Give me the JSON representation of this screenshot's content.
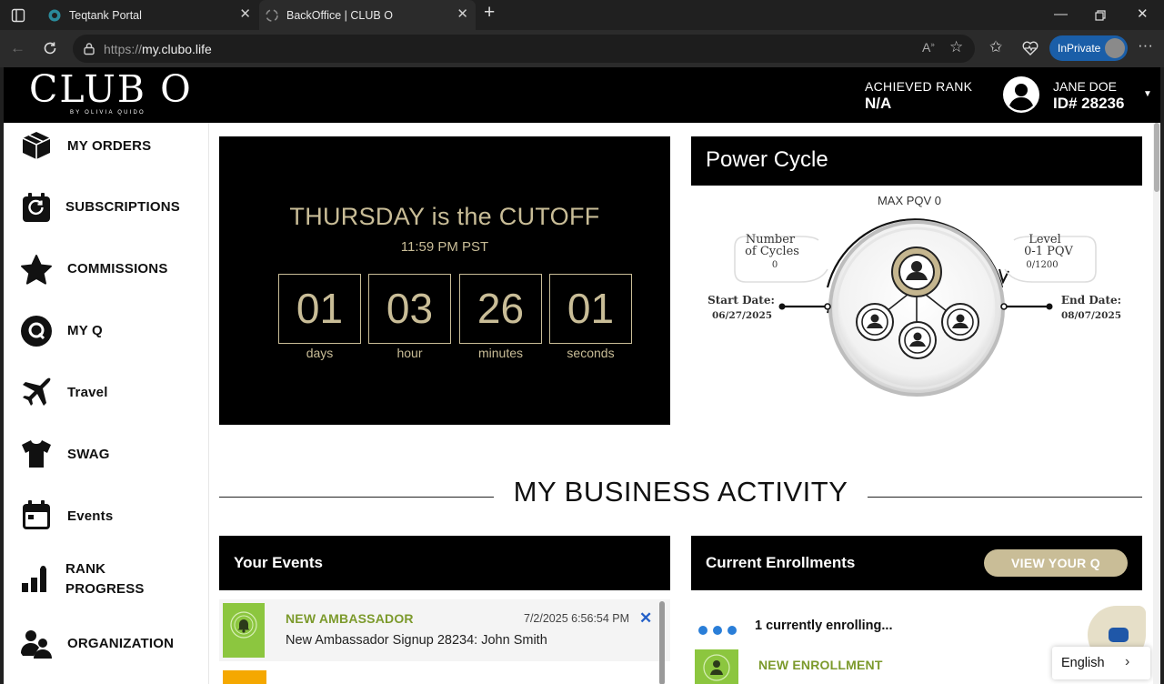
{
  "browser": {
    "tabs": [
      {
        "title": "Teqtank Portal",
        "icon": "teqtank-icon"
      },
      {
        "title": "BackOffice | CLUB O",
        "icon": "loading-icon",
        "active": true
      }
    ],
    "new_tab": "+",
    "url_prefix": "https://",
    "url_host": "my.clubo.life",
    "inprivate_label": "InPrivate"
  },
  "header": {
    "logo_text": "CLUB O",
    "logo_sub": "BY OLIVIA QUIDO",
    "rank_label": "ACHIEVED RANK",
    "rank_value": "N/A",
    "user_name": "JANE DOE",
    "user_id": "ID# 28236"
  },
  "sidebar": {
    "items": [
      {
        "label": "MY ORDERS",
        "icon": "box-icon"
      },
      {
        "label": "SUBSCRIPTIONS",
        "icon": "refresh-calendar-icon"
      },
      {
        "label": "COMMISSIONS",
        "icon": "star-icon"
      },
      {
        "label": "MY Q",
        "icon": "q-icon"
      },
      {
        "label": "Travel",
        "icon": "airplane-icon"
      },
      {
        "label": "SWAG",
        "icon": "tshirt-icon"
      },
      {
        "label": "Events",
        "icon": "calendar-icon"
      },
      {
        "label": "RANK PROGRESS",
        "label_line1": "RANK",
        "label_line2": "PROGRESS",
        "icon": "bar-chart-icon"
      },
      {
        "label": "ORGANIZATION",
        "icon": "group-icon"
      }
    ]
  },
  "countdown": {
    "title": "THURSDAY is the CUTOFF",
    "subtitle": "11:59 PM PST",
    "units": [
      {
        "value": "01",
        "label": "days"
      },
      {
        "value": "03",
        "label": "hour"
      },
      {
        "value": "26",
        "label": "minutes"
      },
      {
        "value": "01",
        "label": "seconds"
      }
    ],
    "color": "#c9bd97"
  },
  "power_cycle": {
    "title": "Power Cycle",
    "max_pqv": "MAX PQV 0",
    "cycles_line1": "Number",
    "cycles_line2": "of Cycles",
    "cycles_value": "0",
    "level_line1": "Level",
    "level_line2": "0-1 PQV",
    "level_value": "0/1200",
    "start_label": "Start Date:",
    "start_date": "06/27/2025",
    "end_label": "End Date:",
    "end_date": "08/07/2025"
  },
  "business": {
    "title": "MY BUSINESS ACTIVITY"
  },
  "events_card": {
    "title": "Your Events",
    "items": [
      {
        "type": "NEW AMBASSADOR",
        "date": "7/2/2025 6:56:54 PM",
        "desc": "New Ambassador Signup 28234: John Smith",
        "close": "✕"
      }
    ]
  },
  "enrollments_card": {
    "title": "Current Enrollments",
    "button": "VIEW YOUR Q",
    "status": "1 currently enrolling...",
    "item_type": "NEW ENROLLMENT"
  },
  "language": {
    "current": "English"
  },
  "colors": {
    "accent_gold": "#c9bd97",
    "event_green": "#8cc63f",
    "type_green": "#7c9a2c",
    "link_blue": "#2460c8"
  }
}
